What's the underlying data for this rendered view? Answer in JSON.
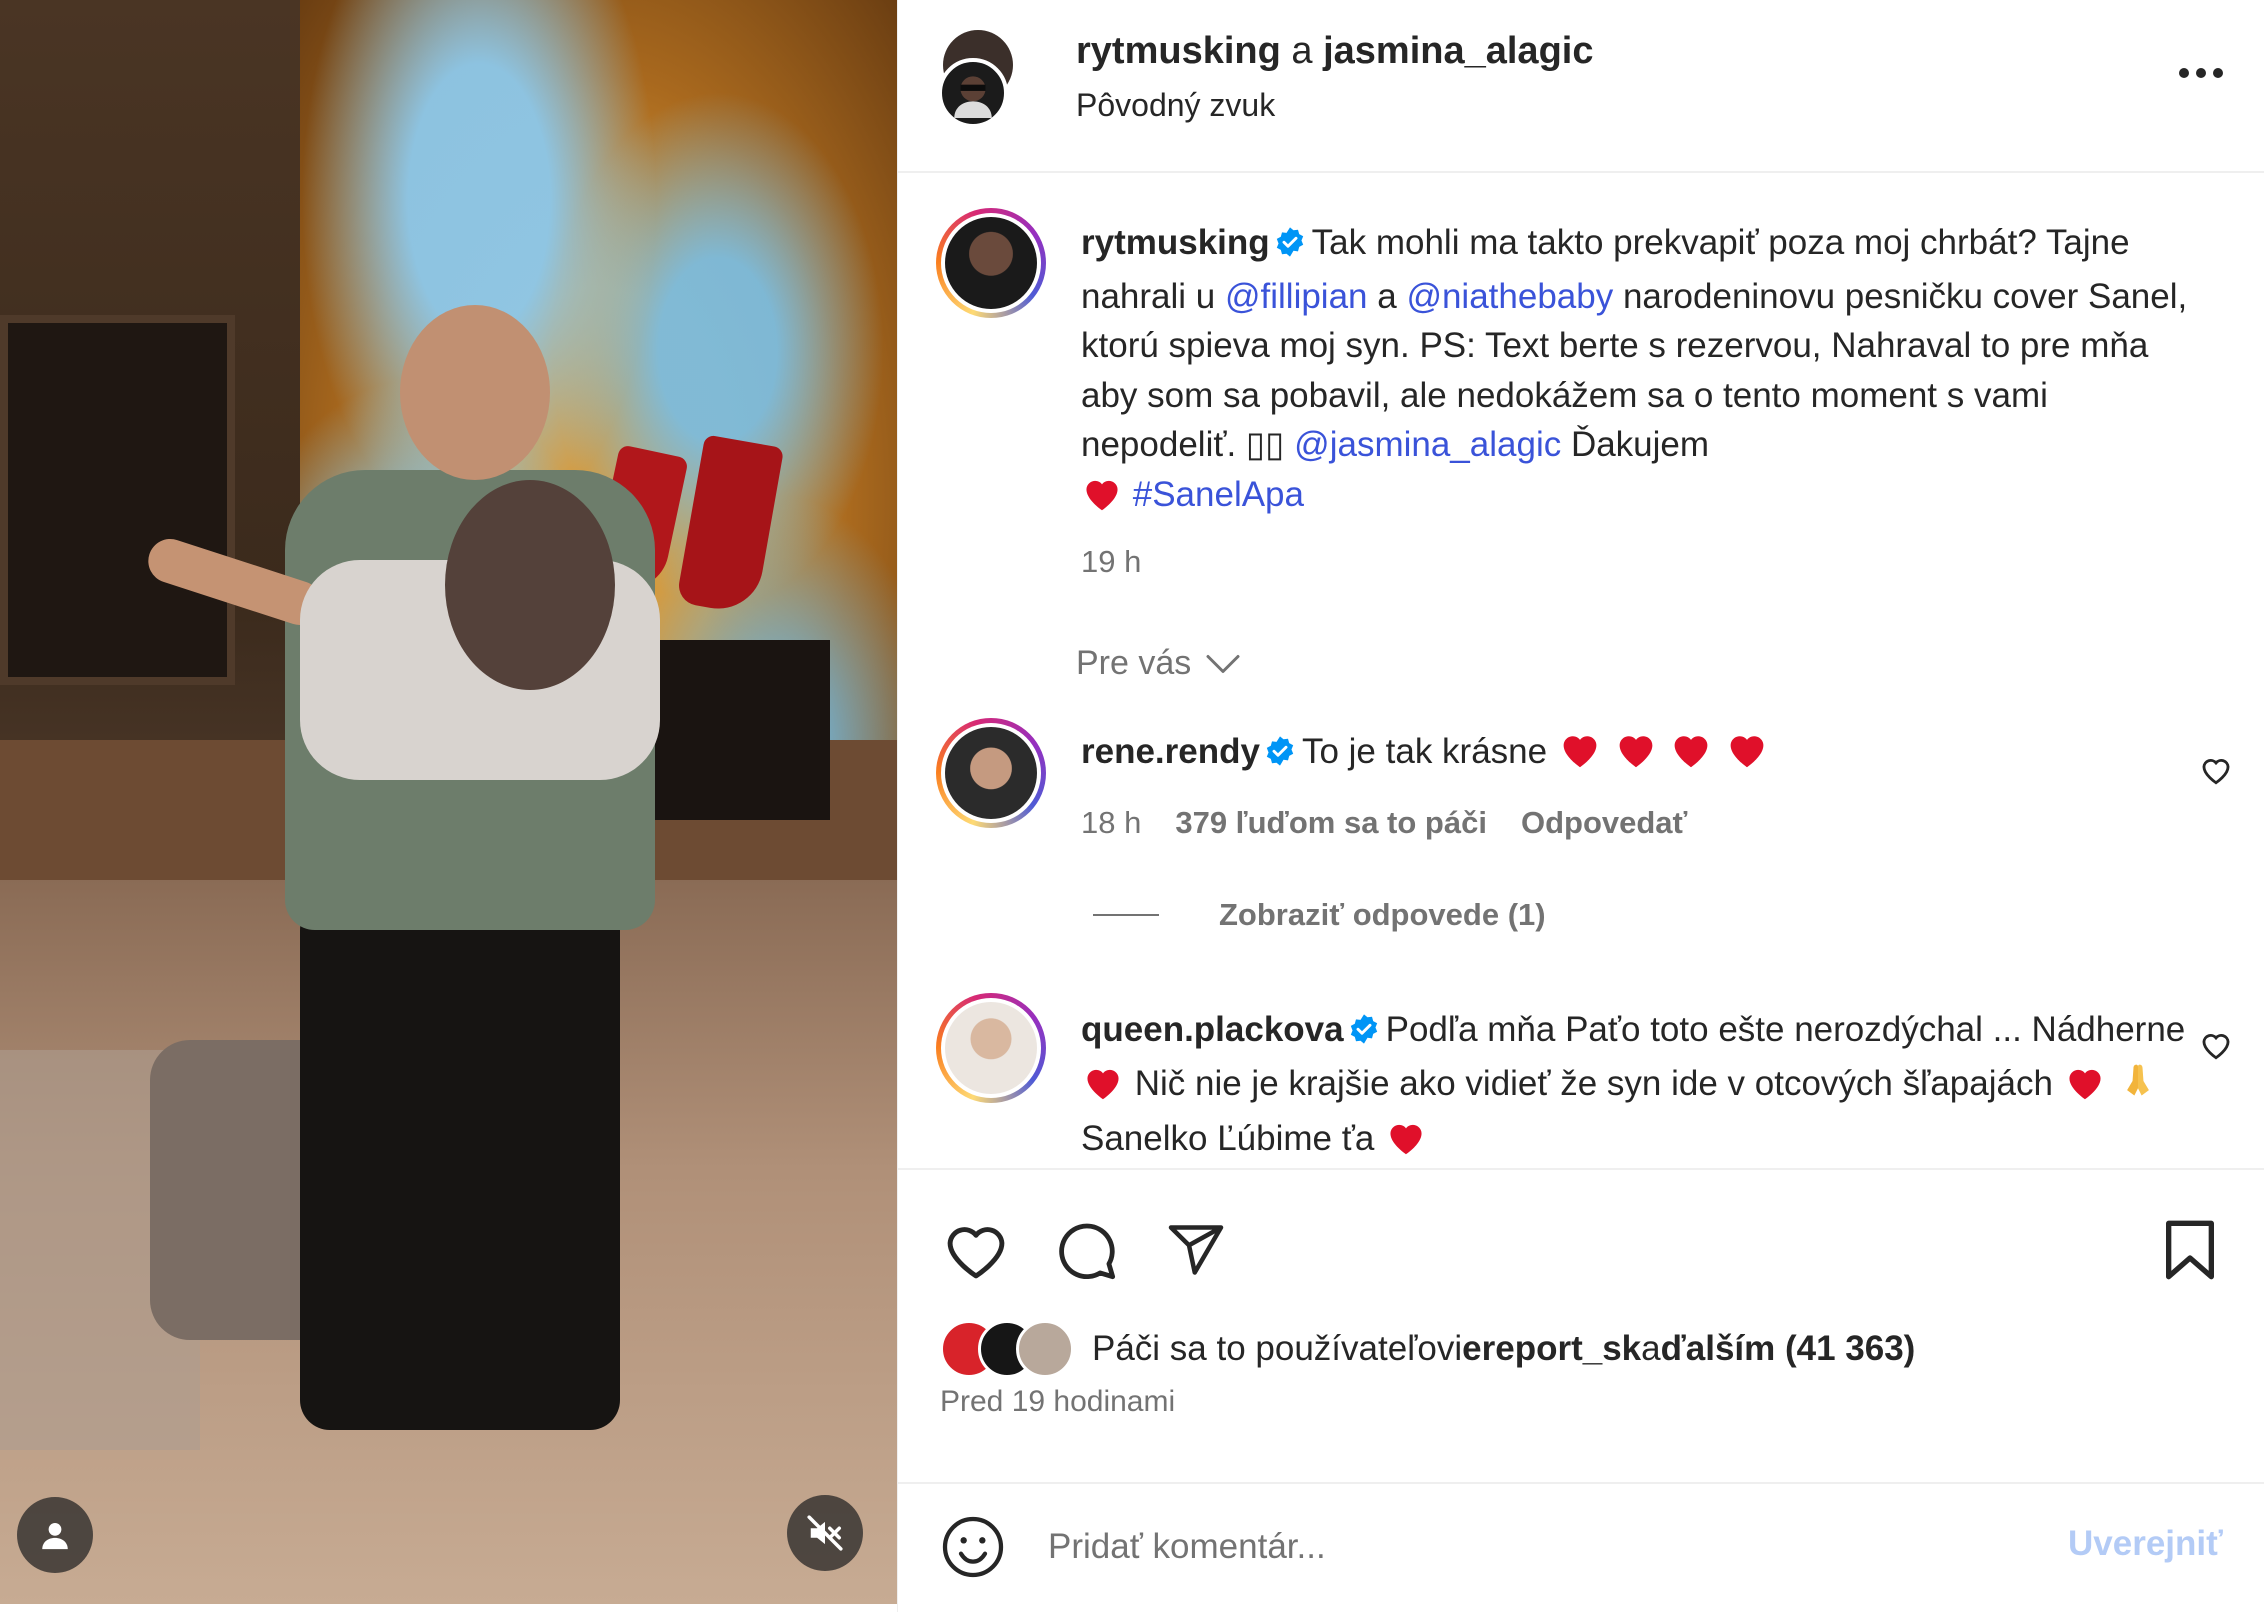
{
  "post": {
    "author": "rytmusking",
    "connector": "a",
    "coauthor": "jasmina_alagic",
    "audio": "Pôvodný zvuk"
  },
  "caption": {
    "username": "rytmusking",
    "text_1": "Tak mohli ma takto prekvapiť poza moj chrbát? Tajne nahrali u ",
    "mention_1": "@fillipian",
    "text_2": " a ",
    "mention_2": "@niathebaby",
    "text_3": " narodeninovu pesničku cover Sanel, ktorú spieva moj syn. PS: Text berte s rezervou, Nahraval to pre mňa aby som sa pobavil, ale nedokážem sa o tento moment s vami nepodeliť. ▯▯ ",
    "mention_3": "@jasmina_alagic",
    "text_4": " Ďakujem ",
    "hashtag": "#SanelApa",
    "time": "19 h"
  },
  "filter": {
    "label": "Pre vás"
  },
  "comments": [
    {
      "username": "rene.rendy",
      "text": "To je tak krásne ",
      "time": "18 h",
      "likes": "379 ľuďom sa to páči",
      "reply": "Odpovedať"
    },
    {
      "username": "queen.plackova",
      "text_1": "Podľa mňa Paťo toto ešte nerozdýchal ... Nádherne ",
      "text_2": " Nič nie je krajšie ako vidieť že syn ide v otcových šľapajách ",
      "text_3": " Sanelko Ľúbime ťa "
    }
  ],
  "replies": {
    "label": "Zobraziť odpovede (1)"
  },
  "likes": {
    "prefix": "Páči sa to používateľovi ",
    "user": "ereport_sk",
    "conn": " a ",
    "others": "ďalším (41 363)"
  },
  "posted": "Pred 19 hodinami",
  "add_comment": {
    "placeholder": "Pridať komentár...",
    "post_label": "Uverejniť"
  },
  "colors": {
    "verified": "#0095f6",
    "heart": "#e0102a",
    "link": "#3a53d9",
    "muted": "#737373",
    "post_disabled": "#b3cbf6"
  },
  "icons": [
    "more-icon",
    "verified-icon",
    "heart-icon",
    "comment-icon",
    "share-icon",
    "bookmark-icon",
    "emoji-icon",
    "chevron-down-icon",
    "user-tag-icon",
    "mute-icon"
  ]
}
